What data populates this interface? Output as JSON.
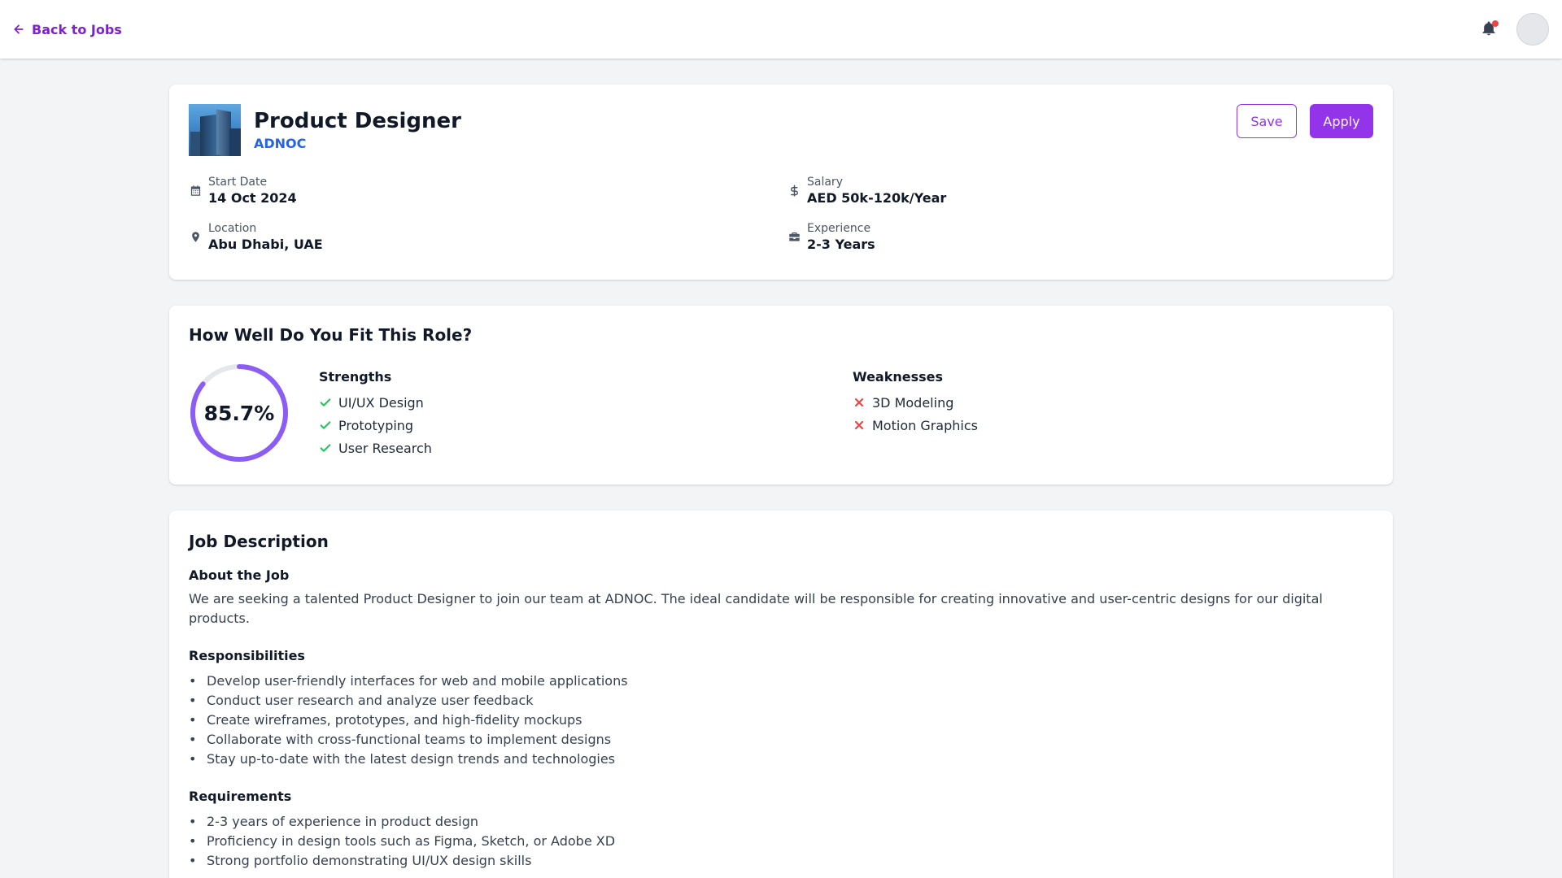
{
  "topbar": {
    "back_label": "Back to Jobs"
  },
  "job": {
    "title": "Product Designer",
    "company": "ADNOC",
    "save_label": "Save",
    "apply_label": "Apply",
    "start_date_label": "Start Date",
    "start_date": "14 Oct 2024",
    "salary_label": "Salary",
    "salary": "AED 50k-120k/Year",
    "location_label": "Location",
    "location": "Abu Dhabi, UAE",
    "experience_label": "Experience",
    "experience": "2-3 Years"
  },
  "fit": {
    "title": "How Well Do You Fit This Role?",
    "score_text": "85.7%",
    "score_value": 85.7,
    "strengths_title": "Strengths",
    "strengths": [
      "UI/UX Design",
      "Prototyping",
      "User Research"
    ],
    "weaknesses_title": "Weaknesses",
    "weaknesses": [
      "3D Modeling",
      "Motion Graphics"
    ]
  },
  "description": {
    "title": "Job Description",
    "about_title": "About the Job",
    "about_text": "We are seeking a talented Product Designer to join our team at ADNOC. The ideal candidate will be responsible for creating innovative and user-centric designs for our digital products.",
    "responsibilities_title": "Responsibilities",
    "responsibilities": [
      "Develop user-friendly interfaces for web and mobile applications",
      "Conduct user research and analyze user feedback",
      "Create wireframes, prototypes, and high-fidelity mockups",
      "Collaborate with cross-functional teams to implement designs",
      "Stay up-to-date with the latest design trends and technologies"
    ],
    "requirements_title": "Requirements",
    "requirements": [
      "2-3 years of experience in product design",
      "Proficiency in design tools such as Figma, Sketch, or Adobe XD",
      "Strong portfolio demonstrating UI/UX design skills"
    ]
  },
  "colors": {
    "accent": "#9333ea",
    "company_link": "#2563eb",
    "check": "#22c55e",
    "cross": "#ef4444",
    "notification_dot": "#ef4444"
  },
  "icons": {
    "back": "arrow-left-icon",
    "notifications": "bell-icon",
    "start_date": "calendar-icon",
    "salary": "dollar-icon",
    "location": "map-pin-icon",
    "experience": "briefcase-icon",
    "strength": "check-icon",
    "weakness": "x-icon"
  }
}
